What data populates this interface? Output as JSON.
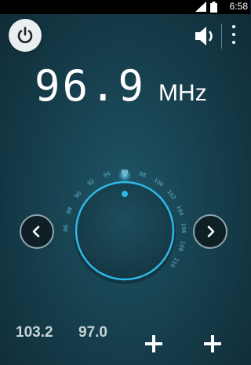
{
  "status_bar": {
    "time": "6:58"
  },
  "frequency": {
    "value": "96.9",
    "unit": "MHz"
  },
  "dial": {
    "current_mark": "96",
    "tick_labels": [
      "86",
      "88",
      "90",
      "92",
      "94",
      "96",
      "98",
      "100",
      "102",
      "104",
      "106",
      "108",
      "110"
    ],
    "accent_color": "#2fb8e8"
  },
  "presets": [
    {
      "label": "103.2"
    },
    {
      "label": "97.0"
    }
  ],
  "icons": {
    "power": "power-icon",
    "volume": "speaker-icon",
    "menu": "overflow-menu-icon",
    "prev": "chevron-left-icon",
    "next": "chevron-right-icon",
    "add": "plus-icon"
  }
}
